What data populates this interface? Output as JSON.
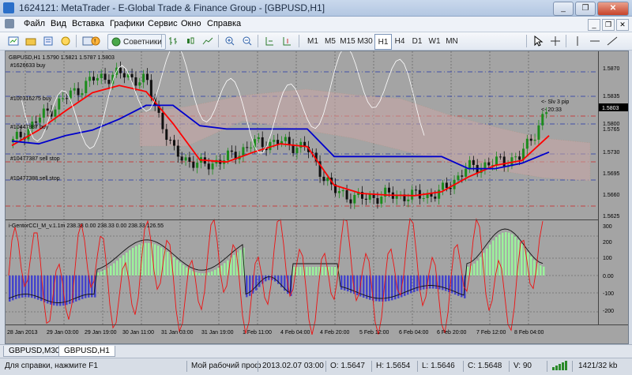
{
  "window": {
    "title": "1624121: MetaTrader - E-Global Trade & Finance Group - [GBPUSD,H1]",
    "minimize": "_",
    "maximize": "❐",
    "close": "✕"
  },
  "menu": {
    "items": [
      "Файл",
      "Вид",
      "Вставка",
      "Графики",
      "Сервис",
      "Окно",
      "Справка"
    ],
    "mdi": [
      "_",
      "❐",
      "✕"
    ]
  },
  "toolbar": {
    "advisors_label": "Советники",
    "periods": [
      "M1",
      "M5",
      "M15",
      "M30",
      "H1",
      "H4",
      "D1",
      "W1",
      "MN"
    ],
    "active_period": "H1"
  },
  "chart": {
    "header": "GBPUSD,H1  1.5790 1.5821 1.5787 1.5803",
    "current_price": "1.5803",
    "price_ticks": [
      "1.5870",
      "1.5835",
      "1.5800",
      "1.5765",
      "1.5730",
      "1.5695",
      "1.5660",
      "1.5625"
    ],
    "order_labels": [
      "#1626633 buy",
      "#100316275 buy",
      "#10447887 buy",
      "#10477387 sell stop",
      "#10477388 sell stop"
    ],
    "annotation_1": "<- Slv 3 pip",
    "annotation_2": "<- 20:33",
    "indicator_header": "i-GentorCCI_M_v.1.1m 238.33 0.00 238.33 0.00 238.33 126.55",
    "indicator_ticks": [
      "300",
      "200",
      "100",
      "0.00",
      "-100",
      "-200"
    ],
    "time_ticks": [
      "28 Jan 2013",
      "29 Jan 03:00",
      "29 Jan 19:00",
      "30 Jan 11:00",
      "31 Jan 03:00",
      "31 Jan 19:00",
      "1 Feb 11:00",
      "4 Feb 04:00",
      "4 Feb 20:00",
      "5 Feb 12:00",
      "6 Feb 04:00",
      "6 Feb 20:00",
      "7 Feb 12:00",
      "8 Feb 04:00"
    ],
    "colors": {
      "background": "#a4a4a4",
      "bull_candle": "#1d8c1d",
      "bear_candle": "#101010",
      "ma_red": "#ff0000",
      "ma_blue": "#0000cc",
      "line_white": "#ffffff",
      "histogram_green": "#9cf29c",
      "histogram_blue": "#4444cc",
      "current_price_box": "#000000"
    }
  },
  "chart_data": {
    "type": "line",
    "series": [
      {
        "values": [
          1.5748,
          1.5792,
          1.583,
          1.5862,
          1.5872,
          1.5858,
          1.573,
          1.5705,
          1.5718,
          1.5745,
          1.5748,
          1.5738,
          1.566,
          1.5645,
          1.5652,
          1.565,
          1.5655,
          1.57,
          1.571,
          1.572,
          1.5803
        ]
      },
      {
        "values": [
          1.5742,
          1.577,
          1.5805,
          1.5838,
          1.5851,
          1.584,
          1.5782,
          1.5716,
          1.5712,
          1.573,
          1.5745,
          1.574,
          1.567,
          1.5655,
          1.5652,
          1.5651,
          1.5658,
          1.5685,
          1.5706,
          1.5715,
          1.576
        ]
      },
      {
        "values": [
          1.575,
          1.5745,
          1.576,
          1.577,
          1.579,
          1.5815,
          1.5815,
          1.5778,
          1.5772,
          1.5772,
          1.5772,
          1.5772,
          1.5722,
          1.5722,
          1.5722,
          1.5722,
          1.5722,
          1.57,
          1.57,
          1.571,
          1.573
        ]
      }
    ],
    "ylim": [
      1.5612,
      1.5893
    ],
    "grid": true
  },
  "tabs": [
    "GBPUSD,M30",
    "GBPUSD,H1"
  ],
  "active_tab": "GBPUSD,H1",
  "status": {
    "help": "Для справки, нажмите F1",
    "profile": "Мой рабочий проф",
    "datetime": "2013.02.07 03:00",
    "open": "O: 1.5647",
    "high": "H: 1.5654",
    "low": "L: 1.5646",
    "close": "C: 1.5648",
    "volume": "V: 90",
    "traffic": "1421/32 kb"
  }
}
